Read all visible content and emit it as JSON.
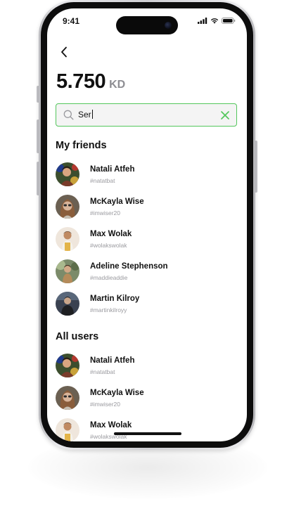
{
  "status_bar": {
    "time": "9:41"
  },
  "header": {
    "back_label": ""
  },
  "balance": {
    "amount": "5.750",
    "currency": "KD"
  },
  "search": {
    "value": "Ser",
    "placeholder": ""
  },
  "sections": {
    "friends_title": "My friends",
    "all_users_title": "All users"
  },
  "friends": [
    {
      "name": "Natali Atfeh",
      "handle": "#natatbat"
    },
    {
      "name": "McKayla Wise",
      "handle": "#imwiser20"
    },
    {
      "name": "Max Wolak",
      "handle": "#wolakswolak"
    },
    {
      "name": "Adeline Stephenson",
      "handle": "#maddieaddie"
    },
    {
      "name": "Martin Kilroy",
      "handle": "#martinkilroyy"
    }
  ],
  "all_users": [
    {
      "name": "Natali Atfeh",
      "handle": "#natatbat"
    },
    {
      "name": "McKayla Wise",
      "handle": "#imwiser20"
    },
    {
      "name": "Max Wolak",
      "handle": "#wolakswolak"
    }
  ],
  "colors": {
    "accent": "#53c65c",
    "search_bg": "#f4f4f4",
    "muted_text": "#9a9a9f"
  }
}
